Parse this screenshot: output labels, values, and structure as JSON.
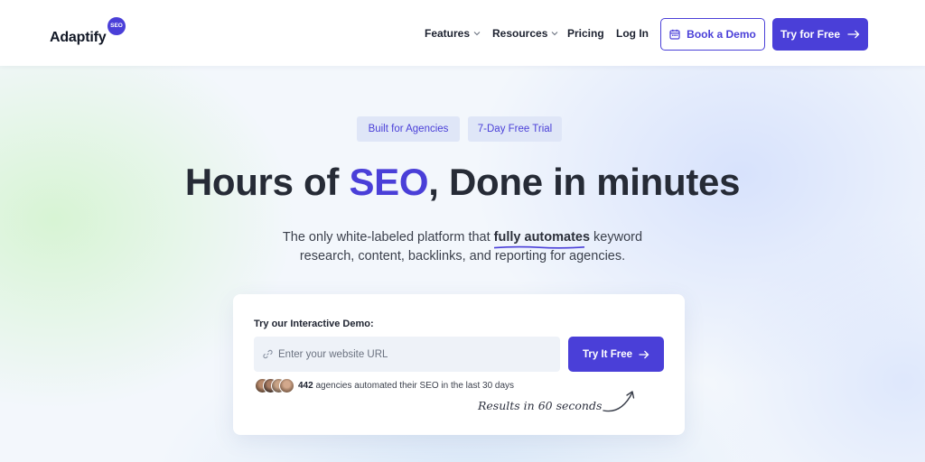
{
  "header": {
    "logo_text": "Adaptify",
    "logo_badge": "SEO",
    "nav": {
      "features": "Features",
      "resources": "Resources",
      "pricing": "Pricing",
      "login": "Log In"
    },
    "book_demo_label": "Book a Demo",
    "try_free_label": "Try for Free"
  },
  "badges": {
    "agencies": "Built for Agencies",
    "trial": "7-Day Free Trial"
  },
  "hero": {
    "headline_before": "Hours of ",
    "headline_accent": "SEO",
    "headline_after": ", Done in minutes",
    "sub_line1_before": "The only white-labeled platform that ",
    "sub_highlight": "fully automates",
    "sub_line1_after": " keyword",
    "sub_line2": "research, content, backlinks, and reporting for agencies."
  },
  "demo": {
    "title": "Try our Interactive Demo:",
    "url_placeholder": "Enter your website URL",
    "url_value": "",
    "try_label": "Try It Free",
    "proof_count": "442",
    "proof_text": " agencies automated their SEO in the last 30 days",
    "results_note": "Results in 60 seconds"
  },
  "colors": {
    "accent": "#4a3fd8",
    "badge_bg": "#dfe6f7",
    "heading": "#262b36"
  }
}
